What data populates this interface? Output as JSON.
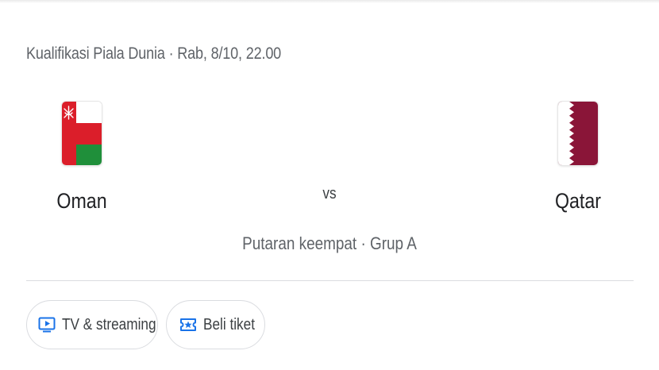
{
  "match": {
    "info": "Kualifikasi Piala Dunia · Rab, 8/10, 22.00",
    "vs": "vs",
    "stage": "Putaran keempat · Grup A"
  },
  "teams": {
    "home": {
      "name": "Oman",
      "flag_icon": "oman-flag-icon"
    },
    "away": {
      "name": "Qatar",
      "flag_icon": "qatar-flag-icon"
    }
  },
  "actions": {
    "tv_label": "TV & streaming",
    "tv_icon": "tv-play-icon",
    "ticket_label": "Beli tiket",
    "ticket_icon": "ticket-star-icon"
  },
  "colors": {
    "oman_red": "#db1e2a",
    "oman_green": "#1f8f3a",
    "qatar_maroon": "#8a1538",
    "icon_blue": "#1a73e8"
  }
}
